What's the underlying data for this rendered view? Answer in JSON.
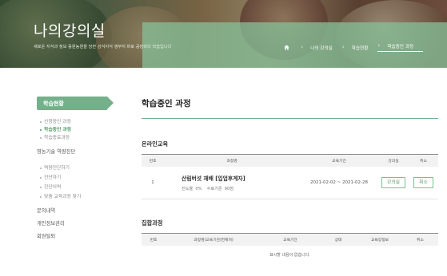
{
  "hero": {
    "title": "나의강의실",
    "subtitle": "새로운 지식과 정보 동원농원을 당한 강식지식 생부지 바로 공장략의 학습입니다"
  },
  "breadcrumb": {
    "items": [
      {
        "label": "나의 강의실"
      },
      {
        "label": "학습현황"
      },
      {
        "label": "학습중인 과정",
        "active": true
      }
    ]
  },
  "sidebar": {
    "header": "학습현황",
    "sub_items": [
      {
        "label": "신청중인 과정",
        "active": false
      },
      {
        "label": "학습중인 과정",
        "active": true
      },
      {
        "label": "학습종료과정",
        "active": false
      }
    ],
    "section2": "영농기술 역량진단",
    "section2_items": [
      {
        "label": "역량진단하기"
      },
      {
        "label": "진단하기"
      },
      {
        "label": "진단이력"
      },
      {
        "label": "맞춤 교육과정 찾기"
      }
    ],
    "links": [
      {
        "label": "문의내역"
      },
      {
        "label": "개인정보관리"
      },
      {
        "label": "회원탈퇴"
      }
    ]
  },
  "main": {
    "page_title": "학습중인 과정",
    "online": {
      "title": "온라인교육",
      "headers": [
        "번호",
        "과정명",
        "교육기간",
        "강의실",
        "취소"
      ],
      "rows": [
        {
          "no": "1",
          "name": "산림버섯 재배 [입업후계자]",
          "progress_label": "진도율",
          "progress_value": "0%",
          "pass_label": "수료기준",
          "pass_value": "90점",
          "period": "2021-02-02 ~ 2021-02-28",
          "room_button": "강의실",
          "cancel_button": "취소"
        }
      ]
    },
    "group": {
      "title": "집합과정",
      "headers": [
        "번호",
        "과정명(교육기관/면제처)",
        "교육기간",
        "상태",
        "교육장정보",
        "취소"
      ],
      "empty_text": "표시할 내용이 없습니다."
    }
  },
  "colors": {
    "accent_green": "#75b08a",
    "button_green": "#4d9c63"
  }
}
